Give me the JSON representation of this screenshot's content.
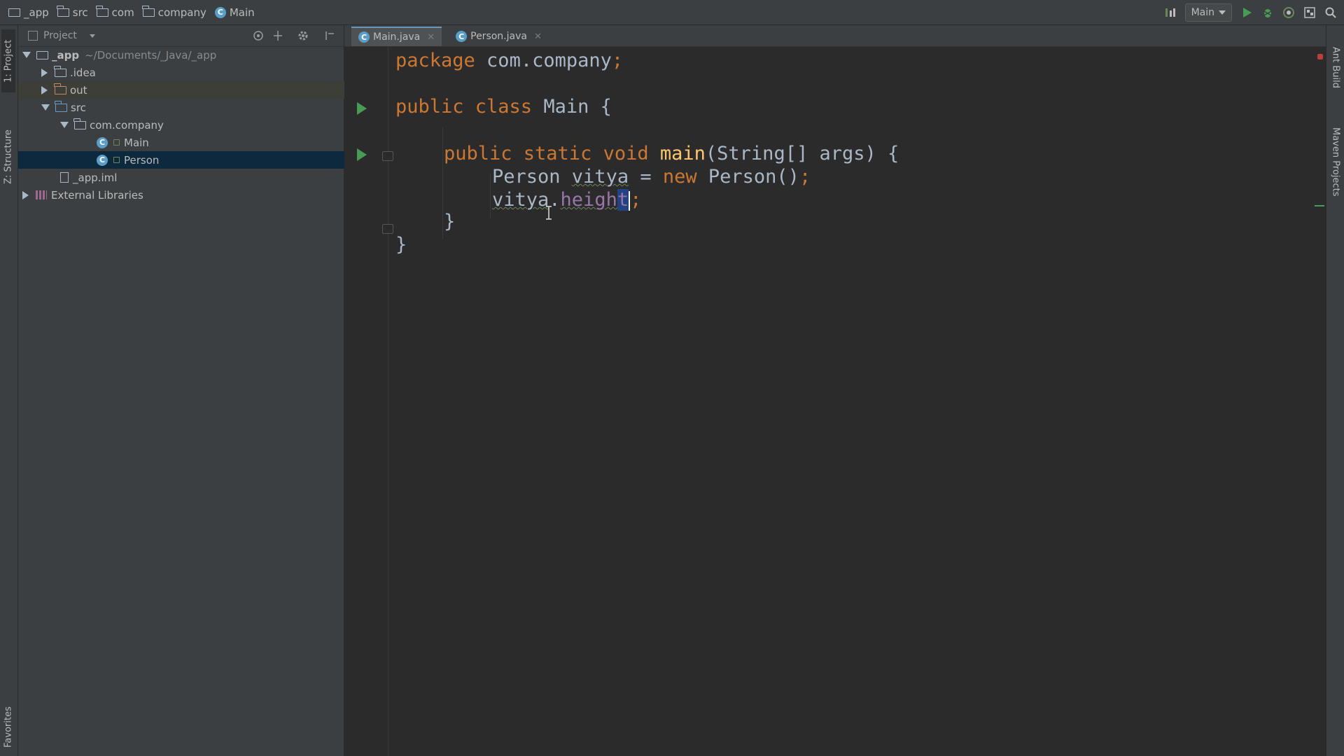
{
  "navbar": {
    "breadcrumbs": [
      {
        "label": "_app",
        "icon": "module-icon"
      },
      {
        "label": "src",
        "icon": "folder-icon"
      },
      {
        "label": "com",
        "icon": "folder-icon"
      },
      {
        "label": "company",
        "icon": "folder-icon"
      },
      {
        "label": "Main",
        "icon": "class-icon"
      }
    ],
    "run_config": "Main"
  },
  "left_stripe": {
    "project_tab": "1: Project",
    "structure_tab": "Z: Structure",
    "favorites_tab": "Favorites"
  },
  "right_stripe": {
    "ant_tab": "Ant Build",
    "maven_tab": "Maven Projects"
  },
  "project_panel": {
    "title": "Project",
    "tree": {
      "root_label": "_app",
      "root_path": "~/Documents/_Java/_app",
      "idea": ".idea",
      "out": "out",
      "src": "src",
      "package": "com.company",
      "main": "Main",
      "person": "Person",
      "iml": "_app.iml",
      "libs": "External Libraries"
    }
  },
  "editor": {
    "tabs": [
      "Main.java",
      "Person.java"
    ],
    "code": {
      "l1_kw": "package",
      "l1_rest": " com.company",
      "semi": ";",
      "l3_kw": "public class",
      "l3_rest": " Main {",
      "l5_kw": "public static void",
      "l5_fn": "main",
      "l5_rest": "(String[] args) {",
      "l6_a": "Person ",
      "l6_var": "vitya",
      "l6_b": " = ",
      "l6_kw": "new",
      "l6_c": " Person()",
      "l7_var": "vitya",
      "l7_dot": ".",
      "l7_fld": "heigh",
      "l7_sel": "t",
      "l8": "}",
      "l9": "}"
    }
  },
  "colors": {
    "keyword": "#cc7832",
    "function": "#ffc66d",
    "field": "#9876aa",
    "run_green": "#499c54"
  }
}
